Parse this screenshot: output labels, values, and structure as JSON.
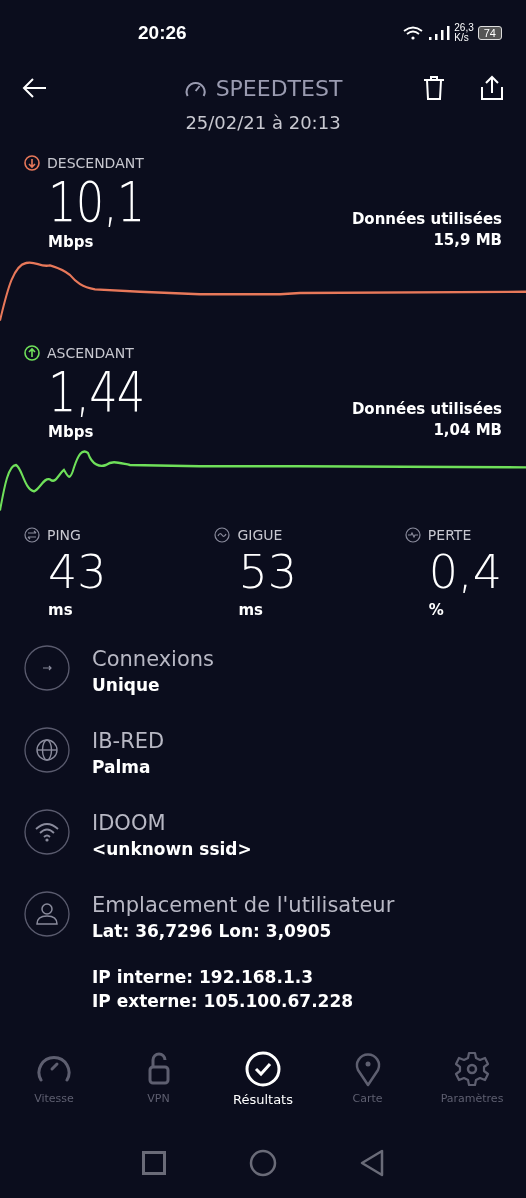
{
  "status_bar": {
    "time": "20:26",
    "speed_value": "26,3",
    "speed_unit": "K/s",
    "battery": "74"
  },
  "header": {
    "title": "SPEEDTEST",
    "date": "25/02/21 à 20:13"
  },
  "transfers": [
    {
      "kind": "download",
      "label": "DESCENDANT",
      "value": "10,1",
      "unit": "Mbps",
      "data_label": "Données utilisées",
      "data_value": "15,9 MB",
      "color": "#e8785a"
    },
    {
      "kind": "upload",
      "label": "ASCENDANT",
      "value": "1,44",
      "unit": "Mbps",
      "data_label": "Données utilisées",
      "data_value": "1,04 MB",
      "color": "#6fe05a"
    }
  ],
  "metrics": [
    {
      "kind": "ping",
      "label": "PING",
      "value": "43",
      "unit": "ms"
    },
    {
      "kind": "jitter",
      "label": "GIGUE",
      "value": "53",
      "unit": "ms"
    },
    {
      "kind": "loss",
      "label": "PERTE",
      "value": "0,4",
      "unit": "%"
    }
  ],
  "info": [
    {
      "kind": "connections",
      "title": "Connexions",
      "value": "Unique"
    },
    {
      "kind": "provider",
      "title": "IB-RED",
      "value": "Palma"
    },
    {
      "kind": "wifi",
      "title": "IDOOM",
      "value": "<unknown ssid>"
    },
    {
      "kind": "location",
      "title": "Emplacement de l'utilisateur",
      "value": "Lat: 36,7296 Lon: 3,0905",
      "details": [
        "IP interne: 192.168.1.3",
        "IP externe: 105.100.67.228"
      ]
    }
  ],
  "tabs": [
    {
      "kind": "speed",
      "label": "Vitesse",
      "selected": false
    },
    {
      "kind": "vpn",
      "label": "VPN",
      "selected": false
    },
    {
      "kind": "results",
      "label": "Résultats",
      "selected": true
    },
    {
      "kind": "map",
      "label": "Carte",
      "selected": false
    },
    {
      "kind": "settings",
      "label": "Paramètres",
      "selected": false
    }
  ]
}
